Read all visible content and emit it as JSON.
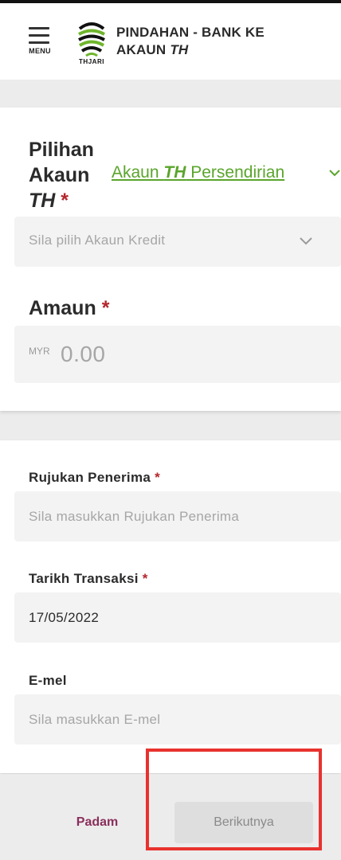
{
  "header": {
    "menu_label": "MENU",
    "logo_text": "THJARI",
    "title_line1": "PINDAHAN - BANK KE",
    "title_line2_prefix": "AKAUN ",
    "title_line2_italic": "TH"
  },
  "account": {
    "label_line1": "Pilihan",
    "label_line2": "Akaun",
    "label_line3": "TH",
    "required": "*",
    "type_prefix": "Akaun ",
    "type_italic": "TH",
    "type_suffix": " Persendirian",
    "credit_placeholder": "Sila pilih Akaun Kredit"
  },
  "amount": {
    "label": "Amaun",
    "required": "*",
    "currency": "MYR",
    "placeholder": "0.00"
  },
  "reference": {
    "label": "Rujukan Penerima",
    "required": "*",
    "placeholder": "Sila masukkan Rujukan Penerima"
  },
  "date": {
    "label": "Tarikh Transaksi",
    "required": "*",
    "value": "17/05/2022"
  },
  "email": {
    "label": "E-mel",
    "placeholder": "Sila masukkan E-mel"
  },
  "footer": {
    "cancel_label": "Padam",
    "next_label": "Berikutnya"
  },
  "colors": {
    "accent_green": "#5aa52b",
    "required_red": "#b3262b",
    "cancel_maroon": "#8a2f5c",
    "highlight_red": "#e8322e"
  }
}
